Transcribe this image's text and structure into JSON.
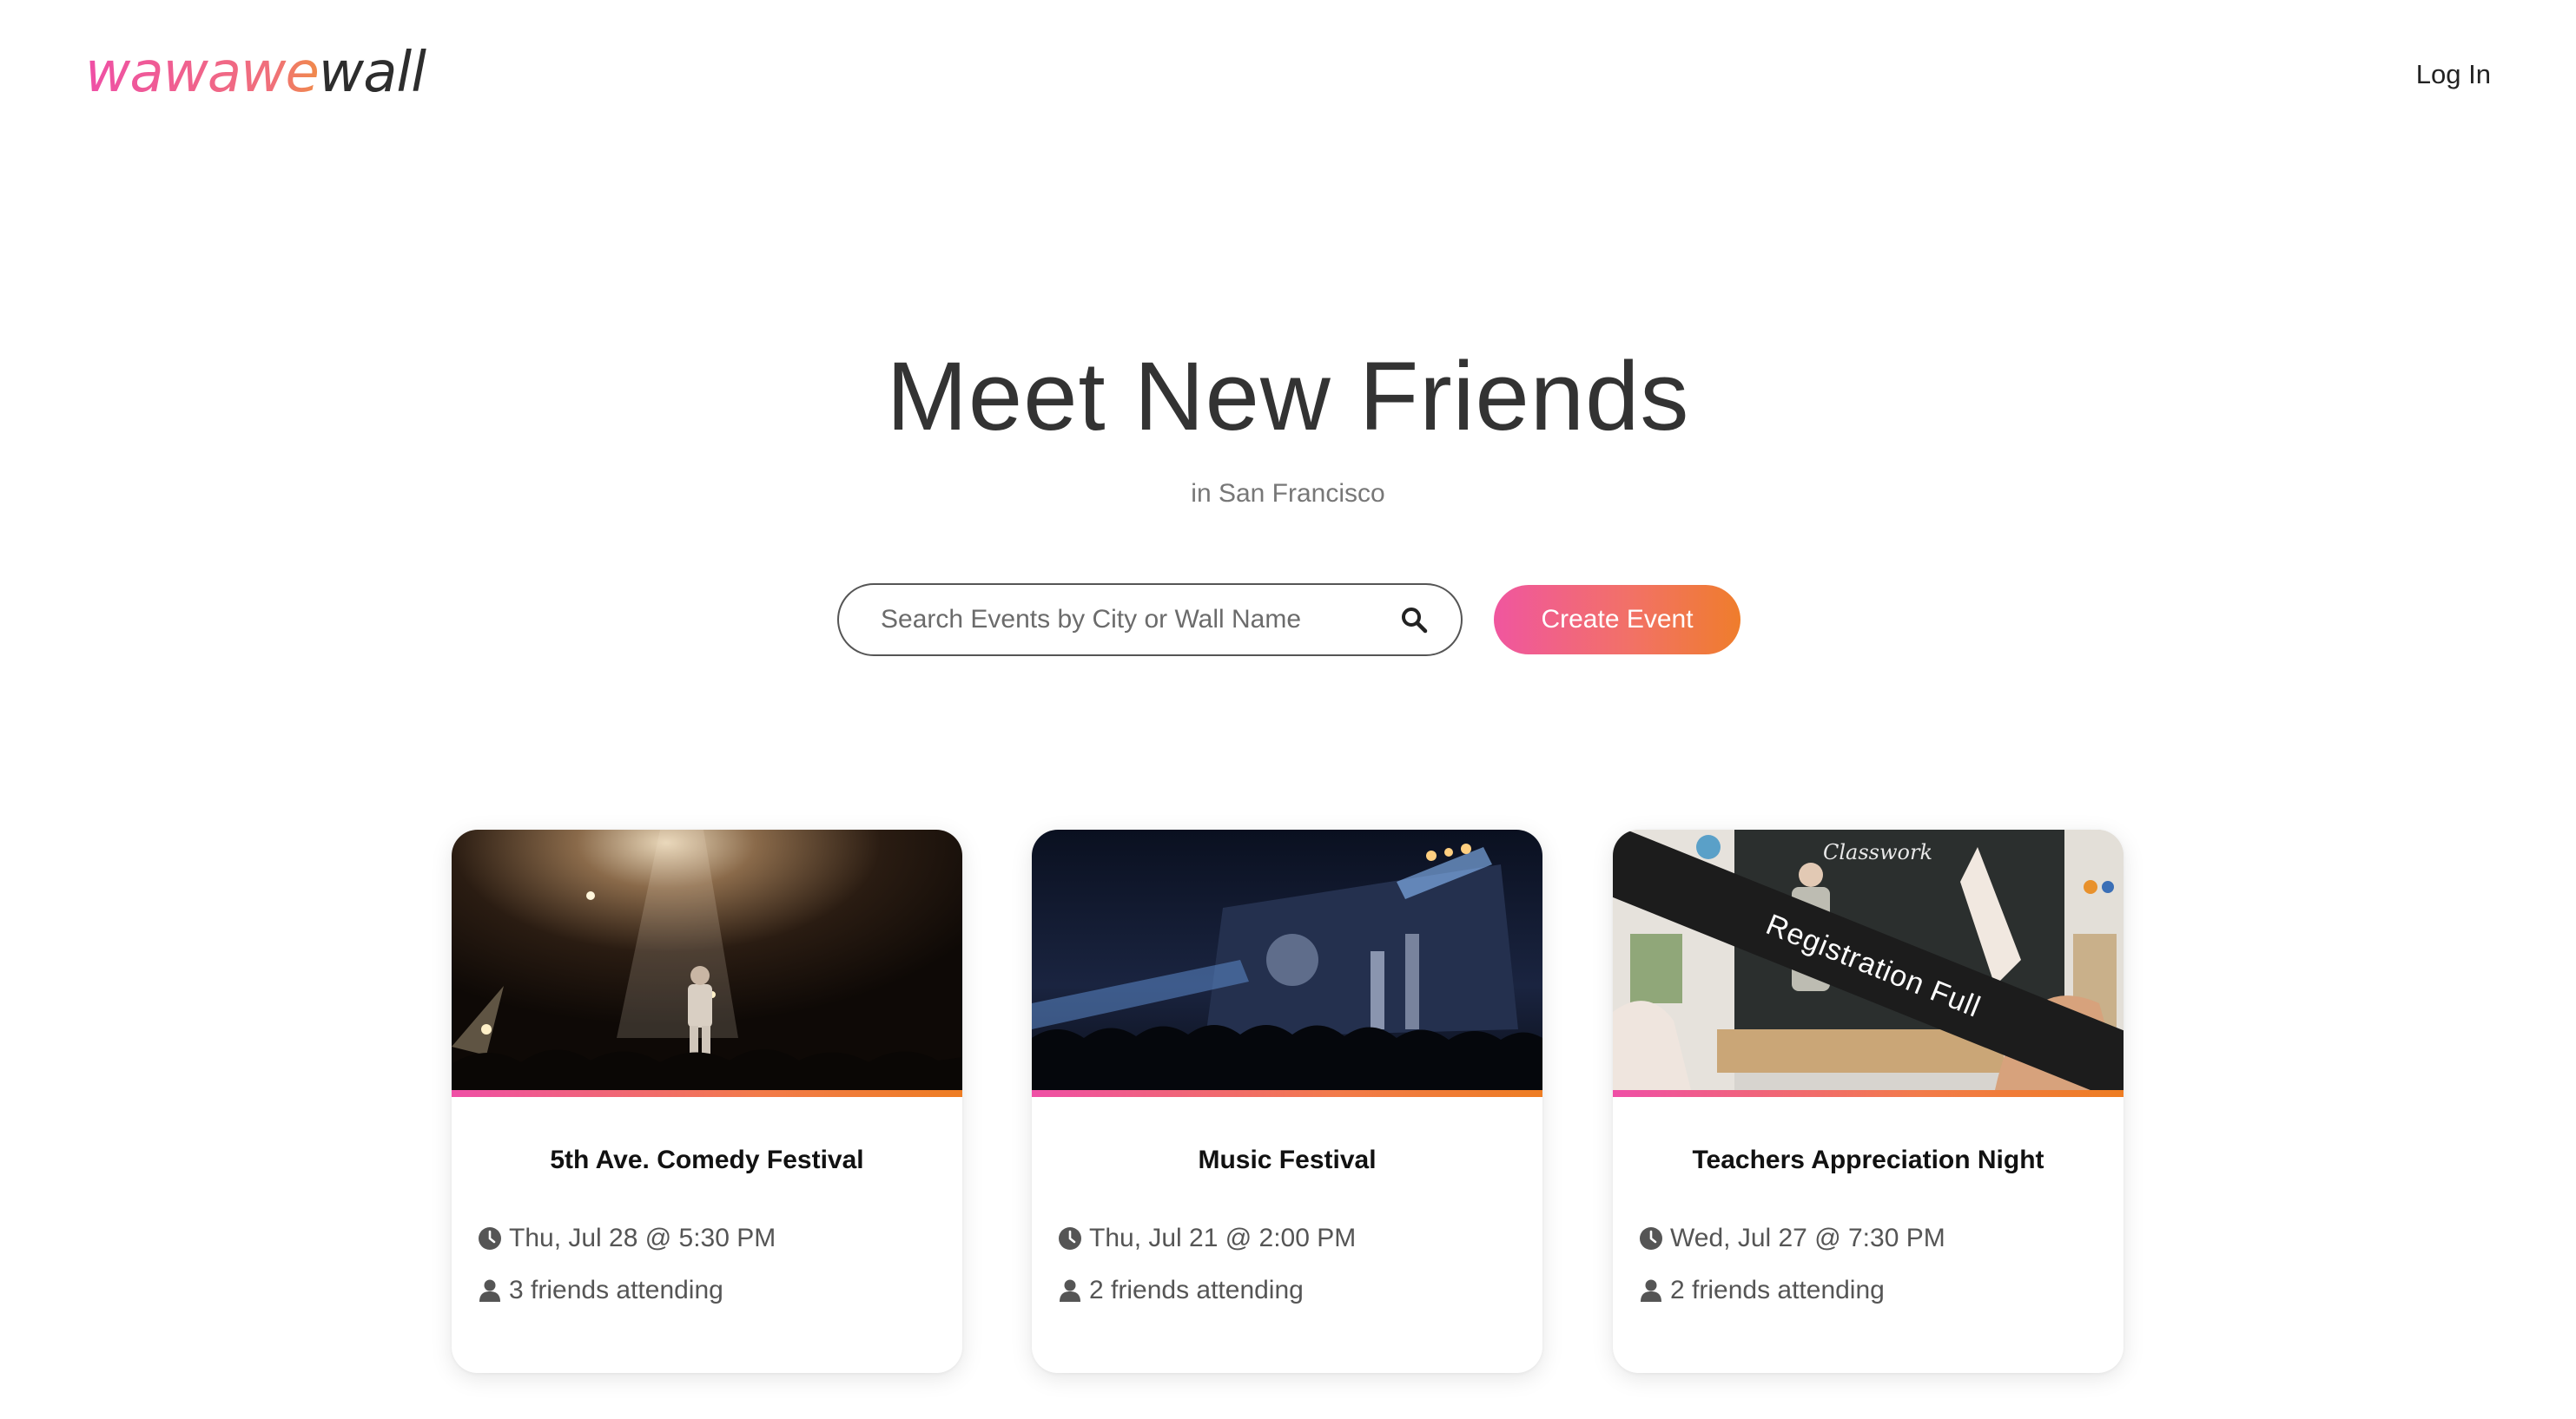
{
  "header": {
    "logo_part1": "wawawe",
    "logo_part2": "wall",
    "login_label": "Log In"
  },
  "hero": {
    "title": "Meet New Friends",
    "subtitle": "in San Francisco"
  },
  "search": {
    "placeholder": "Search Events by City or Wall Name",
    "value": ""
  },
  "create_event_label": "Create Event",
  "events": [
    {
      "title": "5th Ave. Comedy Festival",
      "date": "Thu, Jul 28 @ 5:30 PM",
      "friends": "3 friends attending",
      "image": "comedy-stage-photo"
    },
    {
      "title": "Music Festival",
      "date": "Thu, Jul 21 @ 2:00 PM",
      "friends": "2 friends attending",
      "image": "concert-crowd-photo"
    },
    {
      "title": "Teachers Appreciation Night",
      "date": "Wed, Jul 27 @ 7:30 PM",
      "friends": "2 friends attending",
      "image": "classroom-photo",
      "chalkboard_text": "Classwork",
      "ribbon": "Registration Full"
    }
  ],
  "colors": {
    "accent_pink": "#ef4fa6",
    "accent_orange": "#ee7d23",
    "text_dark": "#2b2b2b",
    "text_muted": "#777777"
  },
  "icons": [
    "search-icon",
    "clock-icon",
    "person-icon"
  ]
}
